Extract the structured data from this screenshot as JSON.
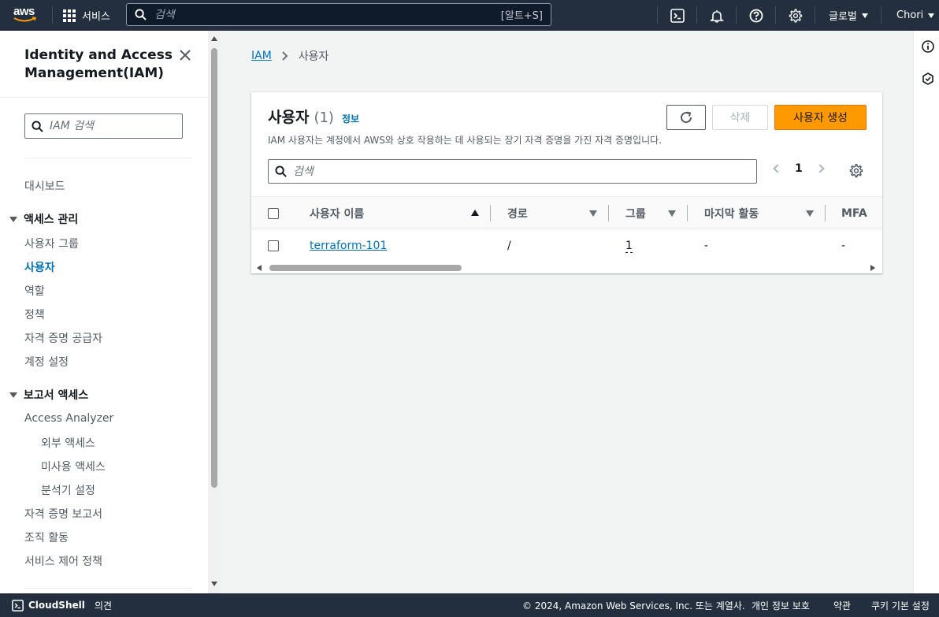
{
  "topnav": {
    "logo_text": "aws",
    "services_label": "서비스",
    "search_placeholder": "검색",
    "search_shortcut": "[알트+S]",
    "region_label": "글로벌",
    "account_label": "Chori"
  },
  "sidebar": {
    "title": "Identity and Access Management(IAM)",
    "search_placeholder": "IAM 검색",
    "dashboard": "대시보드",
    "access_mgmt": {
      "label": "액세스 관리",
      "items": [
        "사용자 그룹",
        "사용자",
        "역할",
        "정책",
        "자격 증명 공급자",
        "계정 설정"
      ]
    },
    "reports": {
      "label": "보고서 액세스",
      "analyzer": "Access Analyzer",
      "analyzer_items": [
        "외부 액세스",
        "미사용 액세스",
        "분석기 설정"
      ],
      "items": [
        "자격 증명 보고서",
        "조직 활동",
        "서비스 제어 정책"
      ]
    }
  },
  "breadcrumb": {
    "root": "IAM",
    "current": "사용자"
  },
  "users_panel": {
    "title": "사용자",
    "count": "(1)",
    "info_link": "정보",
    "description": "IAM 사용자는 계정에서 AWS와 상호 작용하는 데 사용되는 장기 자격 증명을 가진 자격 증명입니다.",
    "delete_label": "삭제",
    "create_label": "사용자 생성",
    "search_placeholder": "검색",
    "page_number": "1",
    "columns": [
      "사용자 이름",
      "경로",
      "그룹",
      "마지막 활동",
      "MFA"
    ],
    "rows": [
      {
        "name": "terraform-101",
        "path": "/",
        "groups": "1",
        "last_activity": "-",
        "mfa": "-"
      }
    ]
  },
  "footer": {
    "cloudshell": "CloudShell",
    "feedback": "의견",
    "copyright": "© 2024, Amazon Web Services, Inc. 또는 계열사.",
    "privacy": "개인 정보 보호",
    "terms": "약관",
    "cookies": "쿠키 기본 설정"
  },
  "colors": {
    "nav_bg": "#232f3e",
    "link": "#0073bb",
    "primary_button": "#ff9900",
    "page_bg": "#f2f3f3"
  },
  "icons": [
    "aws-logo",
    "grid-icon",
    "search-icon",
    "cloudshell-icon",
    "bell-icon",
    "help-icon",
    "gear-icon",
    "close-icon",
    "refresh-icon",
    "info-icon",
    "feedback-icon"
  ]
}
